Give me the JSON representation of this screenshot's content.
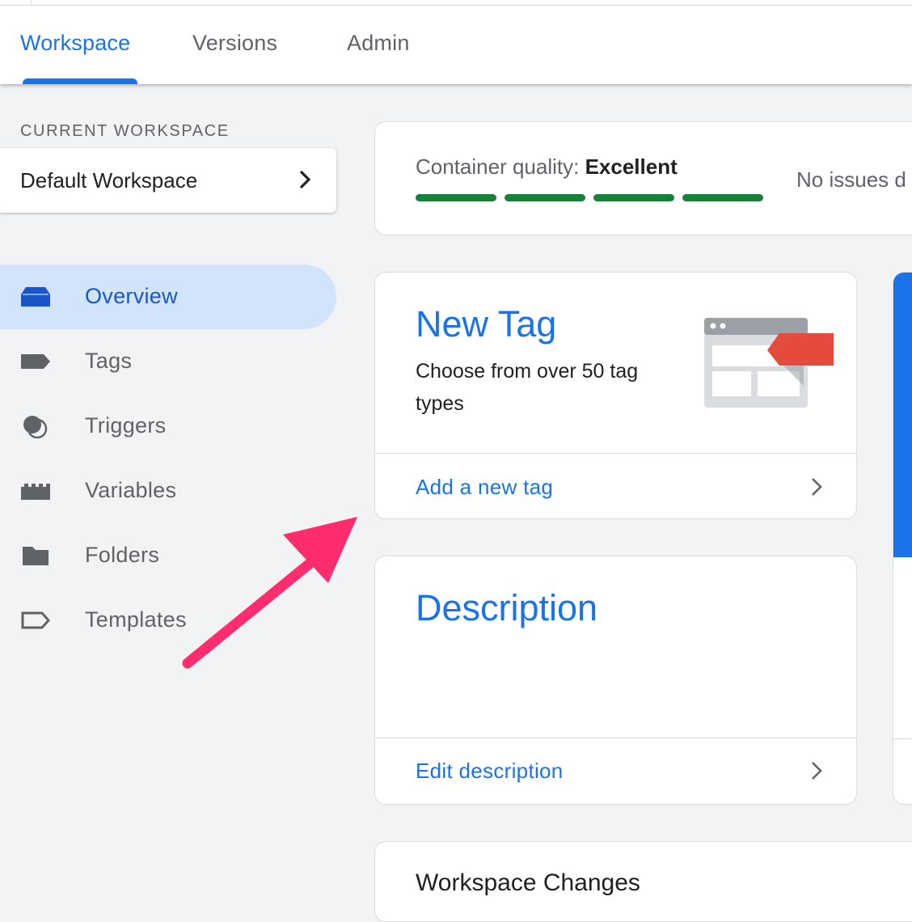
{
  "tabs": [
    {
      "label": "Workspace",
      "active": true
    },
    {
      "label": "Versions",
      "active": false
    },
    {
      "label": "Admin",
      "active": false
    }
  ],
  "workspace": {
    "section_label": "CURRENT WORKSPACE",
    "name": "Default Workspace"
  },
  "nav": [
    {
      "label": "Overview",
      "icon": "overview-icon",
      "active": true
    },
    {
      "label": "Tags",
      "icon": "tag-icon",
      "active": false
    },
    {
      "label": "Triggers",
      "icon": "trigger-icon",
      "active": false
    },
    {
      "label": "Variables",
      "icon": "variables-icon",
      "active": false
    },
    {
      "label": "Folders",
      "icon": "folder-icon",
      "active": false
    },
    {
      "label": "Templates",
      "icon": "template-icon",
      "active": false
    }
  ],
  "quality": {
    "label": "Container quality:",
    "value": "Excellent",
    "status_text": "No issues d",
    "segments_filled": 4,
    "segments_total": 4,
    "color": "#188038"
  },
  "new_tag": {
    "title": "New Tag",
    "subtitle": "Choose from over 50 tag types",
    "link": "Add a new tag"
  },
  "description": {
    "title": "Description",
    "link": "Edit description"
  },
  "changes": {
    "title": "Workspace Changes"
  },
  "colors": {
    "accent": "#1a73e8",
    "nav_active_bg": "#d2e3fc",
    "quality_green": "#188038",
    "annotation_arrow": "#ff2d6f",
    "tag_red": "#e54b3c"
  }
}
